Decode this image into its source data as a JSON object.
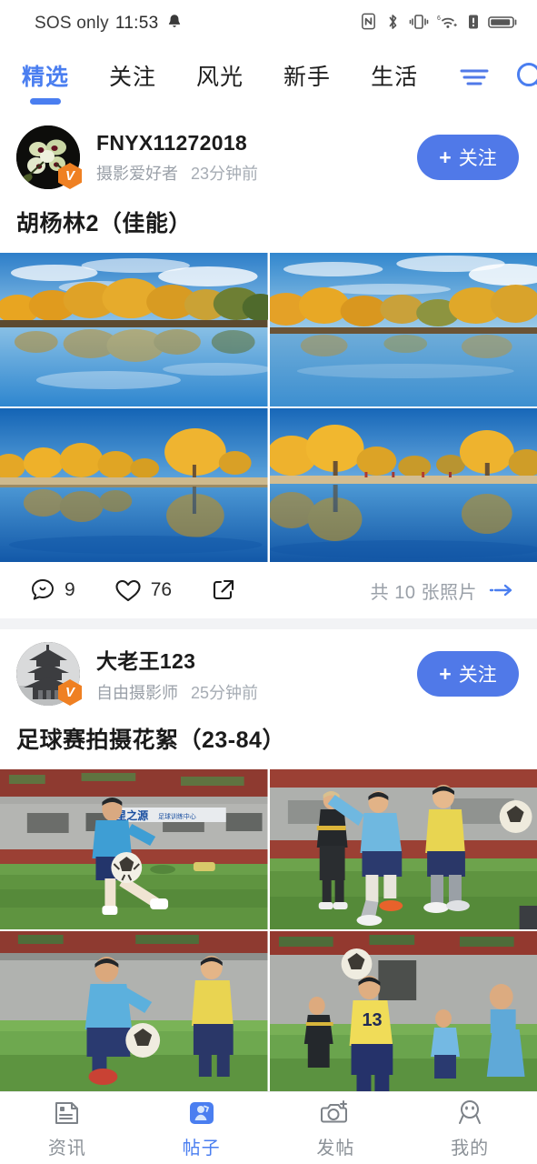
{
  "status_bar": {
    "carrier": "SOS only",
    "time": "11:53",
    "icons": [
      "bell-icon",
      "nfc-icon",
      "bluetooth-icon",
      "vibrate-icon",
      "wifi-6-icon",
      "alert-icon",
      "battery-icon"
    ]
  },
  "top_tabs": {
    "items": [
      {
        "label": "精选",
        "active": true
      },
      {
        "label": "关注",
        "active": false
      },
      {
        "label": "风光",
        "active": false
      },
      {
        "label": "新手",
        "active": false
      },
      {
        "label": "生活",
        "active": false
      }
    ],
    "actions": [
      {
        "name": "filter-icon",
        "label": ""
      },
      {
        "name": "search-icon",
        "label": ""
      }
    ],
    "accent_color": "#4a7ef0"
  },
  "posts": [
    {
      "user_name": "FNYX11272018",
      "user_role": "摄影爱好者",
      "time": "23分钟前",
      "verified_badge": "V",
      "avatar": "orchid-photo",
      "follow_label": "关注",
      "follow_plus": "+",
      "title": "胡杨林2（佳能）",
      "comments": "9",
      "likes": "76",
      "photo_count_text": "共 10 张照片",
      "photos": [
        "poplar-lake-1",
        "poplar-lake-2",
        "poplar-lake-3",
        "poplar-lake-4"
      ]
    },
    {
      "user_name": "大老王123",
      "user_role": "自由摄影师",
      "time": "25分钟前",
      "verified_badge": "V",
      "avatar": "pagoda-photo",
      "follow_label": "关注",
      "follow_plus": "+",
      "title": "足球赛拍摄花絮（23-84）",
      "photos": [
        "soccer-1",
        "soccer-2",
        "soccer-3",
        "soccer-4"
      ]
    }
  ],
  "bottom_nav": {
    "items": [
      {
        "label": "资讯",
        "icon": "news-icon",
        "active": false
      },
      {
        "label": "帖子",
        "icon": "posts-icon",
        "active": true
      },
      {
        "label": "发帖",
        "icon": "camera-plus-icon",
        "active": false
      },
      {
        "label": "我的",
        "icon": "profile-smiley-icon",
        "active": false
      }
    ],
    "active_color": "#4a7ef0",
    "inactive_color": "#8c9298"
  }
}
